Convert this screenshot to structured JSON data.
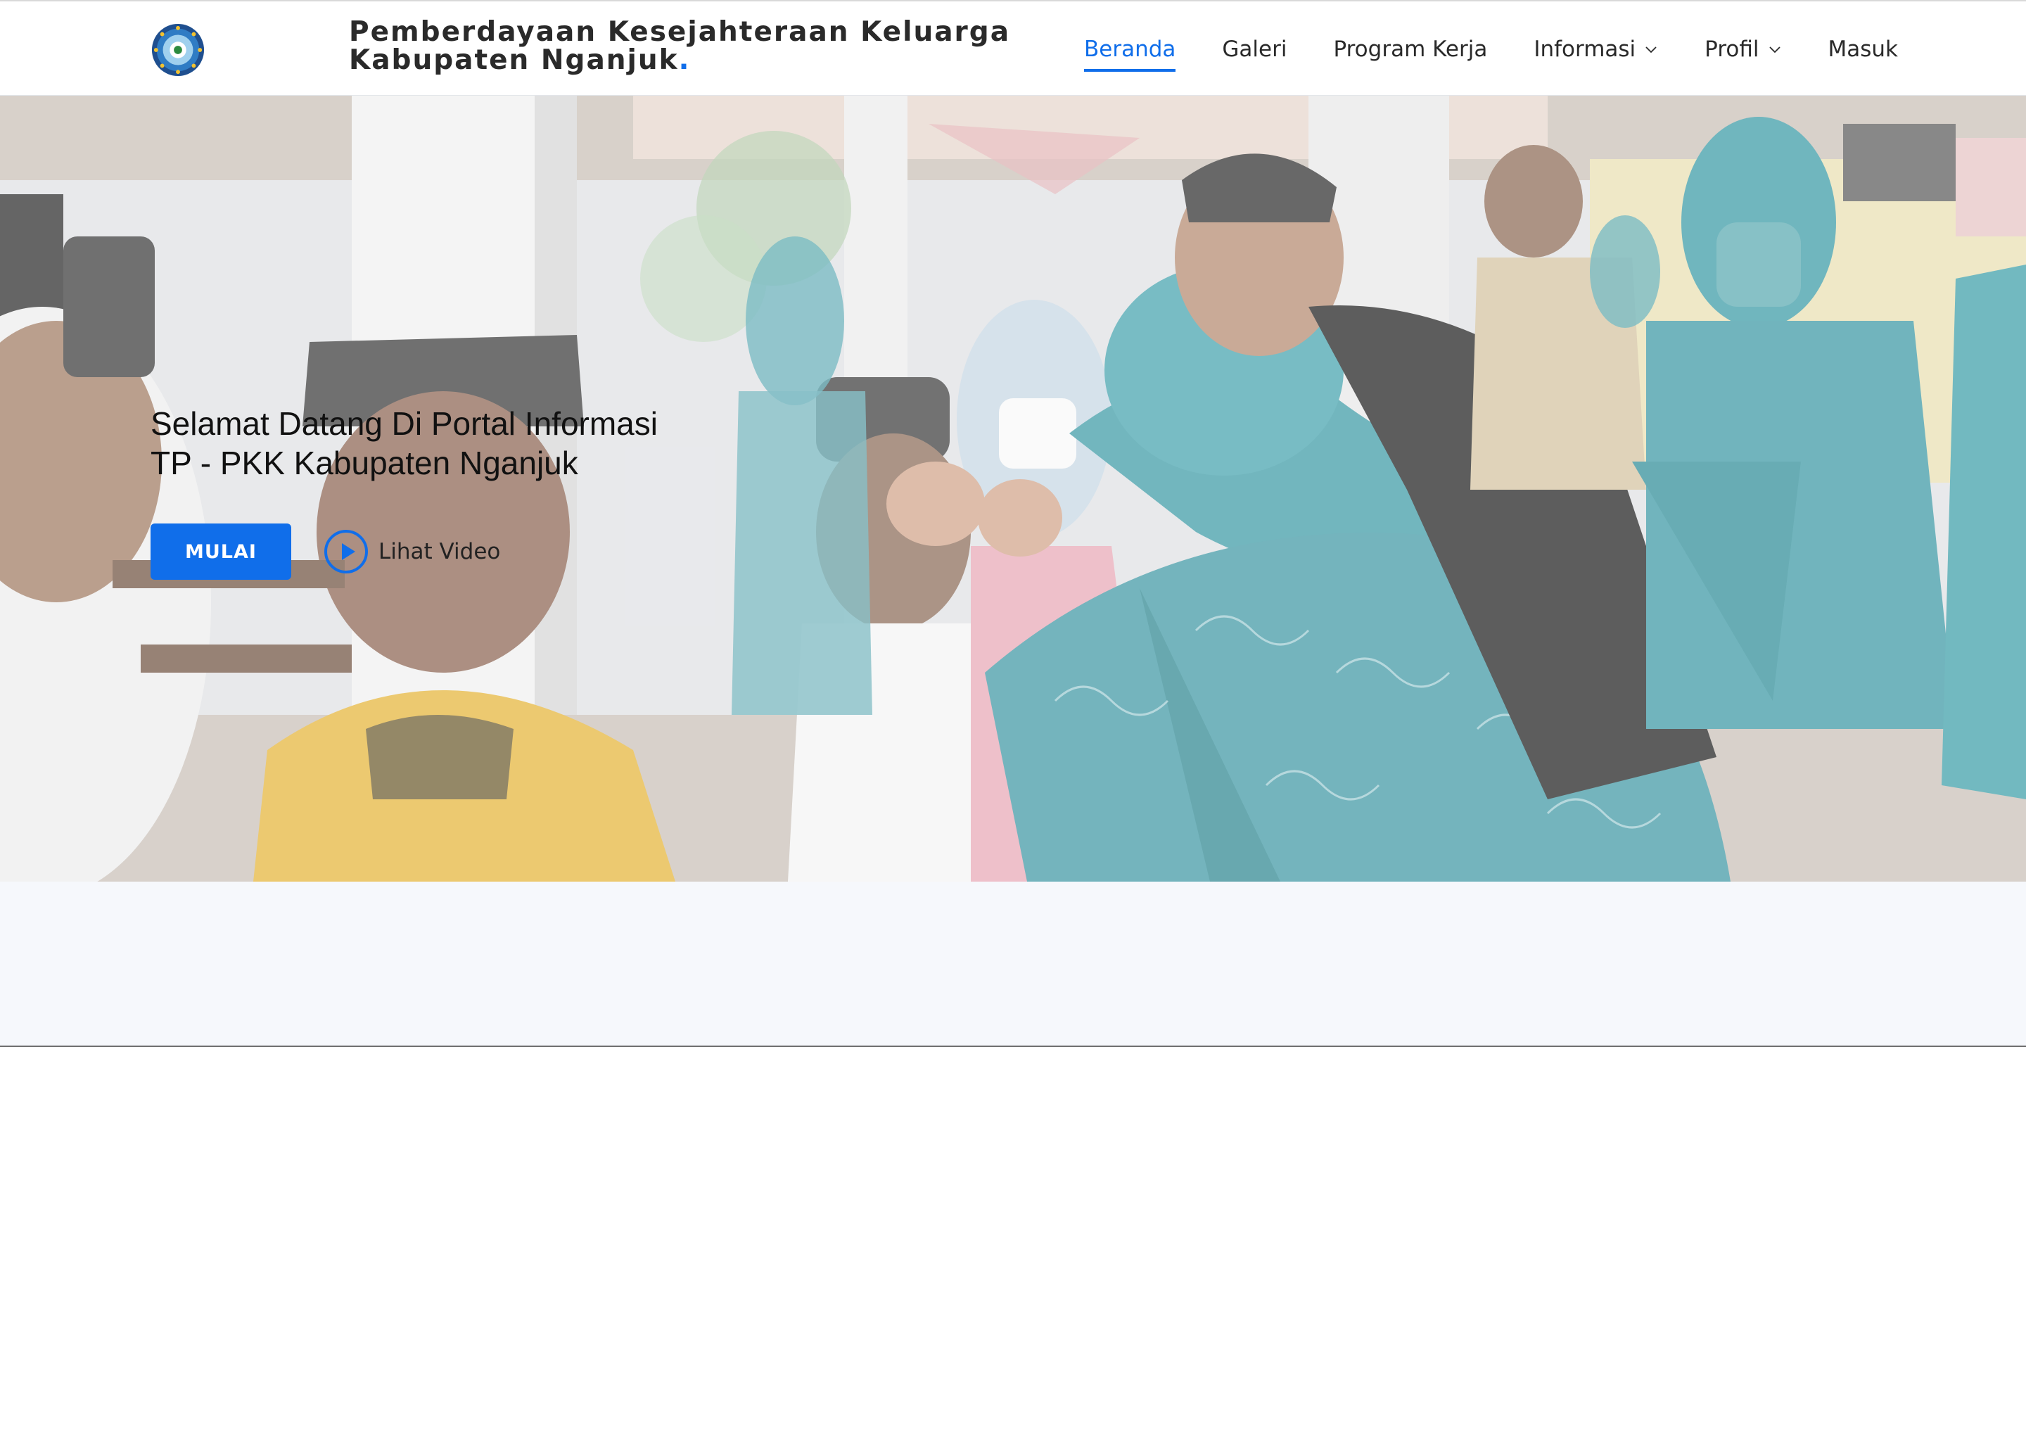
{
  "header": {
    "brand_line1": "Pemberdayaan Kesejahteraan Keluarga",
    "brand_line2": "Kabupaten Nganjuk",
    "brand_dot": ".",
    "logo_icon": "pkk-emblem-icon"
  },
  "nav": {
    "items": [
      {
        "label": "Beranda",
        "active": true
      },
      {
        "label": "Galeri"
      },
      {
        "label": "Program Kerja"
      },
      {
        "label": "Informasi",
        "dropdown": true
      },
      {
        "label": "Profil",
        "dropdown": true
      },
      {
        "label": "Masuk"
      }
    ]
  },
  "hero": {
    "title_line1": "Selamat Datang Di Portal Informasi",
    "title_line2": "TP - PKK Kabupaten Nganjuk",
    "start_button": "MULAI",
    "video_link": "Lihat Video",
    "video_icon": "play-circle-icon"
  },
  "colors": {
    "accent": "#106eea",
    "text": "#2a2a2a",
    "band": "#f6f8fc"
  }
}
